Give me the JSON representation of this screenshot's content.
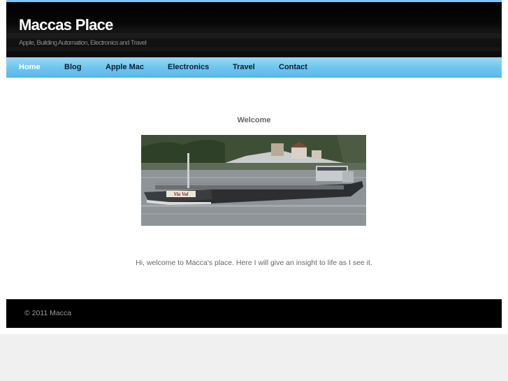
{
  "header": {
    "title": "Maccas Place",
    "tagline": "Apple, Building Automation, Electronics and Travel"
  },
  "nav": {
    "items": [
      {
        "label": "Home",
        "active": true
      },
      {
        "label": "Blog",
        "active": false
      },
      {
        "label": "Apple Mac",
        "active": false
      },
      {
        "label": "Electronics",
        "active": false
      },
      {
        "label": "Travel",
        "active": false
      },
      {
        "label": "Contact",
        "active": false
      }
    ]
  },
  "main": {
    "heading": "Welcome",
    "image": {
      "description_icon": "river-barge-photo",
      "boat_name": "Via Val"
    },
    "intro": "Hi, welcome to Macca's place. Here I will give an insight to life as I see it."
  },
  "footer": {
    "copyright": "© 2011 Macca"
  },
  "colors": {
    "header_bg": "#000000",
    "nav_accent": "#6ec4ee",
    "nav_active_text": "#ffffff",
    "nav_text": "#0b1d33",
    "page_bg": "#f0f0f0"
  }
}
